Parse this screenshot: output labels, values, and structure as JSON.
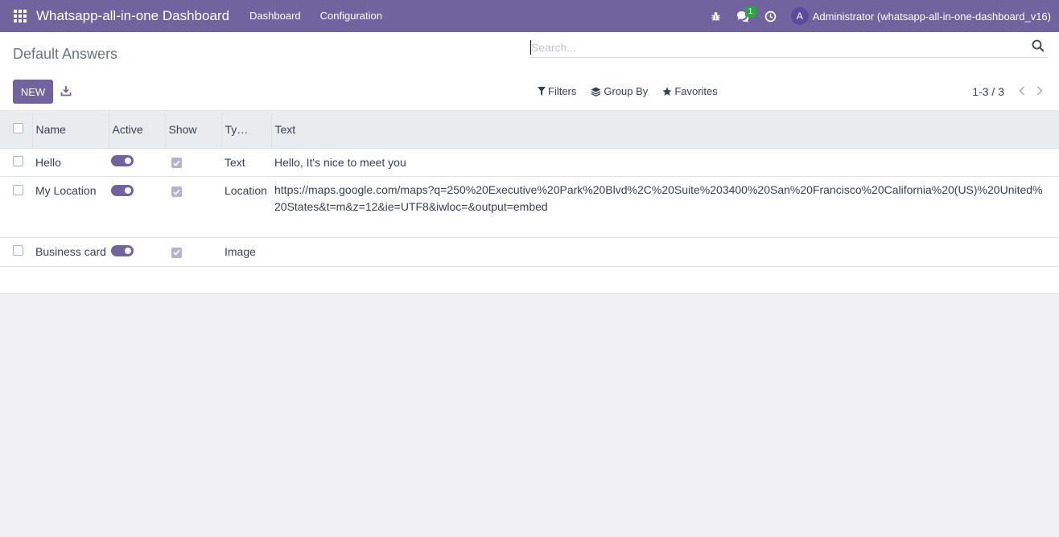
{
  "navbar": {
    "brand": "Whatsapp-all-in-one Dashboard",
    "menu": [
      "Dashboard",
      "Configuration"
    ],
    "messages_badge": "1",
    "user_initial": "A",
    "user_name": "Administrator (whatsapp-all-in-one-dashboard_v16)",
    "bg_color": "#71639e"
  },
  "control_panel": {
    "title": "Default Answers",
    "search_placeholder": "Search...",
    "new_label": "NEW",
    "filters_label": "Filters",
    "group_by_label": "Group By",
    "favorites_label": "Favorites",
    "pager": "1-3 / 3"
  },
  "table": {
    "columns": [
      "Name",
      "Active",
      "Show",
      "Ty…",
      "Text"
    ],
    "rows": [
      {
        "name": "Hello",
        "active": true,
        "show": true,
        "type": "Text",
        "text": "Hello, It's nice to meet you"
      },
      {
        "name": "My Location",
        "active": true,
        "show": true,
        "type": "Location",
        "text": "https://maps.google.com/maps?q=250%20Executive%20Park%20Blvd%2C%20Suite%203400%20San%20Francisco%20California%20(US)%20United%20States&t=m&z=12&ie=UTF8&iwloc=&output=embed"
      },
      {
        "name": "Business card",
        "active": true,
        "show": true,
        "type": "Image",
        "text": ""
      }
    ]
  },
  "icons": {
    "apps": "apps-grid-icon",
    "debug": "bug-icon",
    "messages": "chat-icon",
    "activity": "clock-icon",
    "search": "search-icon",
    "download": "download-icon",
    "filters": "filter-icon",
    "group_by": "layers-icon",
    "favorites": "star-icon"
  }
}
